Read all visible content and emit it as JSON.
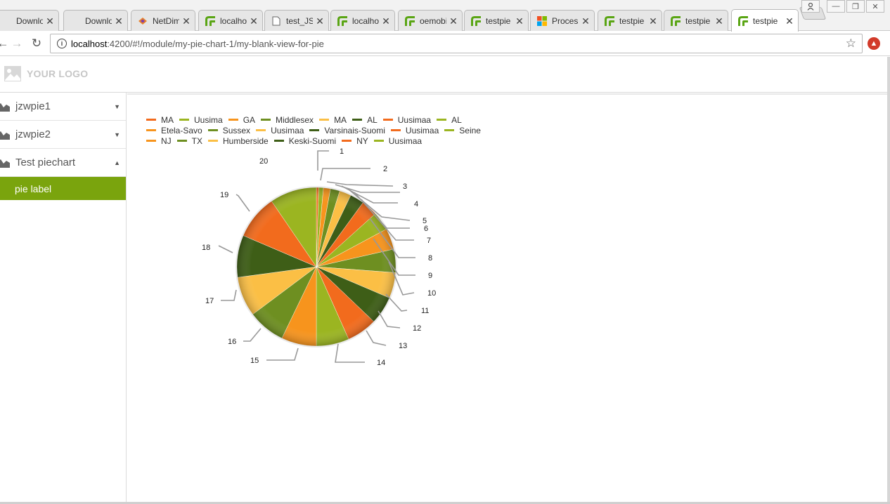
{
  "browser": {
    "tabs": [
      {
        "label": "Downlo",
        "icon": "blank-icon"
      },
      {
        "label": "Downlo",
        "icon": "blank-icon"
      },
      {
        "label": "NetDim",
        "icon": "netdim-icon"
      },
      {
        "label": "localho",
        "icon": "app-green-icon"
      },
      {
        "label": "test_JS",
        "icon": "document-icon"
      },
      {
        "label": "localho",
        "icon": "app-green-icon"
      },
      {
        "label": "oemobi",
        "icon": "app-green-icon"
      },
      {
        "label": "testpie",
        "icon": "app-green-icon"
      },
      {
        "label": "Proces",
        "icon": "microsoft-icon"
      },
      {
        "label": "testpie",
        "icon": "app-green-icon"
      },
      {
        "label": "testpie",
        "icon": "app-green-icon"
      },
      {
        "label": "testpie",
        "icon": "app-green-icon",
        "active": true
      }
    ],
    "address": {
      "host": "localhost",
      "rest": ":4200/#!/module/my-pie-chart-1/my-blank-view-for-pie"
    }
  },
  "app": {
    "logo_text": "YOUR LOGO",
    "nav": [
      {
        "label": "jzwpie1",
        "caret": "down"
      },
      {
        "label": "jzwpie2",
        "caret": "down"
      },
      {
        "label": "Test piechart",
        "caret": "up"
      }
    ],
    "active_subitem": "pie label",
    "accent_color": "#7aa40d"
  },
  "legend": [
    [
      {
        "label": "MA",
        "color": "#f26b1d"
      },
      {
        "label": "Uusima",
        "color": "#9bb521"
      },
      {
        "label": "GA",
        "color": "#f7941d"
      },
      {
        "label": "Middlesex",
        "color": "#6e8f21"
      },
      {
        "label": "MA",
        "color": "#fbbf45"
      },
      {
        "label": "AL",
        "color": "#3e5e17"
      },
      {
        "label": "Uusimaa",
        "color": "#f26b1d"
      },
      {
        "label": "AL",
        "color": "#9bb521"
      }
    ],
    [
      {
        "label": "Etela-Savo",
        "color": "#f7941d"
      },
      {
        "label": "Sussex",
        "color": "#6e8f21"
      },
      {
        "label": "Uusimaa",
        "color": "#fbbf45"
      },
      {
        "label": "Varsinais-Suomi",
        "color": "#3e5e17"
      },
      {
        "label": "Uusimaa",
        "color": "#f26b1d"
      },
      {
        "label": "Seine",
        "color": "#9bb521"
      }
    ],
    [
      {
        "label": "NJ",
        "color": "#f7941d"
      },
      {
        "label": "TX",
        "color": "#6e8f21"
      },
      {
        "label": "Humberside",
        "color": "#fbbf45"
      },
      {
        "label": "Keski-Suomi",
        "color": "#3e5e17"
      },
      {
        "label": "NY",
        "color": "#f26b1d"
      },
      {
        "label": "Uusimaa",
        "color": "#9bb521"
      }
    ]
  ],
  "chart_data": {
    "type": "pie",
    "categories": [
      "MA",
      "Uusima",
      "GA",
      "Middlesex",
      "MA",
      "AL",
      "Uusimaa",
      "AL",
      "Etela-Savo",
      "Sussex",
      "Uusimaa",
      "Varsinais-Suomi",
      "Uusimaa",
      "Seine",
      "NJ",
      "TX",
      "Humberside",
      "Keski-Suomi",
      "NY",
      "Uusimaa"
    ],
    "values": [
      1,
      2,
      3,
      4,
      5,
      6,
      7,
      8,
      9,
      10,
      11,
      12,
      13,
      14,
      15,
      16,
      17,
      18,
      19,
      20
    ],
    "slice_labels": [
      "1",
      "2",
      "3",
      "4",
      "5",
      "6",
      "7",
      "8",
      "9",
      "10",
      "11",
      "12",
      "13",
      "14",
      "15",
      "16",
      "17",
      "18",
      "19",
      "20"
    ],
    "colors": [
      "#f26b1d",
      "#9bb521",
      "#f7941d",
      "#6e8f21",
      "#fbbf45",
      "#3e5e17"
    ],
    "legend_position": "top-left"
  }
}
